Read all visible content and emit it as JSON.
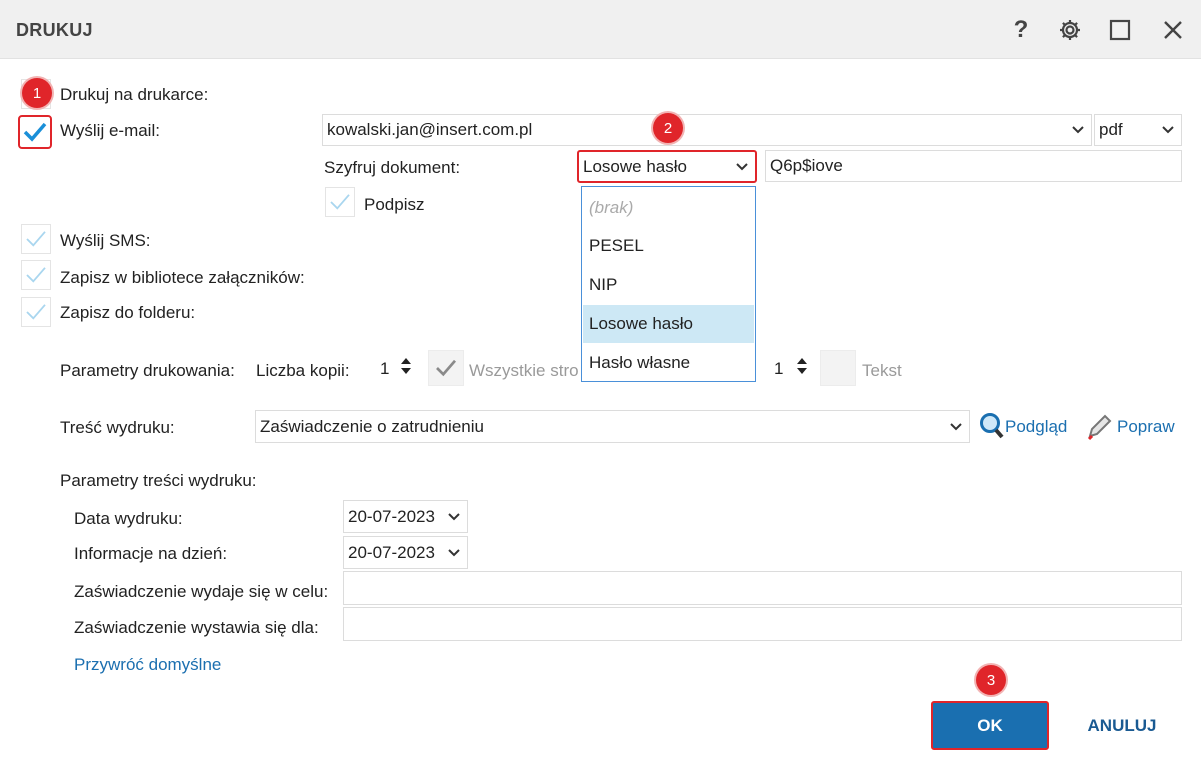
{
  "window": {
    "title": "DRUKUJ",
    "icons": [
      "help-icon",
      "gear-icon",
      "maximize-icon",
      "close-icon"
    ],
    "help_glyph": "?"
  },
  "options": {
    "print_label": "Drukuj na drukarce:",
    "email_label": "Wyślij e-mail:",
    "sms_label": "Wyślij SMS:",
    "library_label": "Zapisz w bibliotece załączników:",
    "folder_label": "Zapisz do folderu:"
  },
  "email": {
    "address": "kowalski.jan@insert.com.pl",
    "format": "pdf",
    "encrypt_label": "Szyfruj dokument:",
    "encrypt_selected": "Losowe hasło",
    "password": "Q6p$iove",
    "sign_label": "Podpisz",
    "encrypt_options": [
      "(brak)",
      "PESEL",
      "NIP",
      "Losowe hasło",
      "Hasło własne"
    ]
  },
  "print_params": {
    "label": "Parametry drukowania:",
    "copies_label": "Liczba kopii:",
    "copies_value": "1",
    "all_pages_label": "Wszystkie stro",
    "second_value": "1",
    "text_label": "Tekst"
  },
  "content": {
    "label": "Treść wydruku:",
    "value": "Zaświadczenie o zatrudnieniu",
    "preview_label": "Podgląd",
    "edit_label": "Popraw"
  },
  "content_params": {
    "label": "Parametry treści wydruku:",
    "print_date_label": "Data wydruku:",
    "print_date_value": "20-07-2023",
    "info_date_label": "Informacje na dzień:",
    "info_date_value": "20-07-2023",
    "purpose_label": "Zaświadczenie wydaje się w celu:",
    "purpose_value": "",
    "issued_for_label": "Zaświadczenie wystawia się dla:",
    "issued_for_value": "",
    "restore_defaults": "Przywróć domyślne"
  },
  "buttons": {
    "ok": "OK",
    "cancel": "ANULUJ"
  },
  "badges": [
    "1",
    "2",
    "3"
  ],
  "colors": {
    "accent": "#1a6fb0",
    "highlight_red": "#e0252a",
    "check_blue": "#1a8fd8",
    "check_light": "#a9d6ef",
    "selected_row": "#cde8f5"
  }
}
